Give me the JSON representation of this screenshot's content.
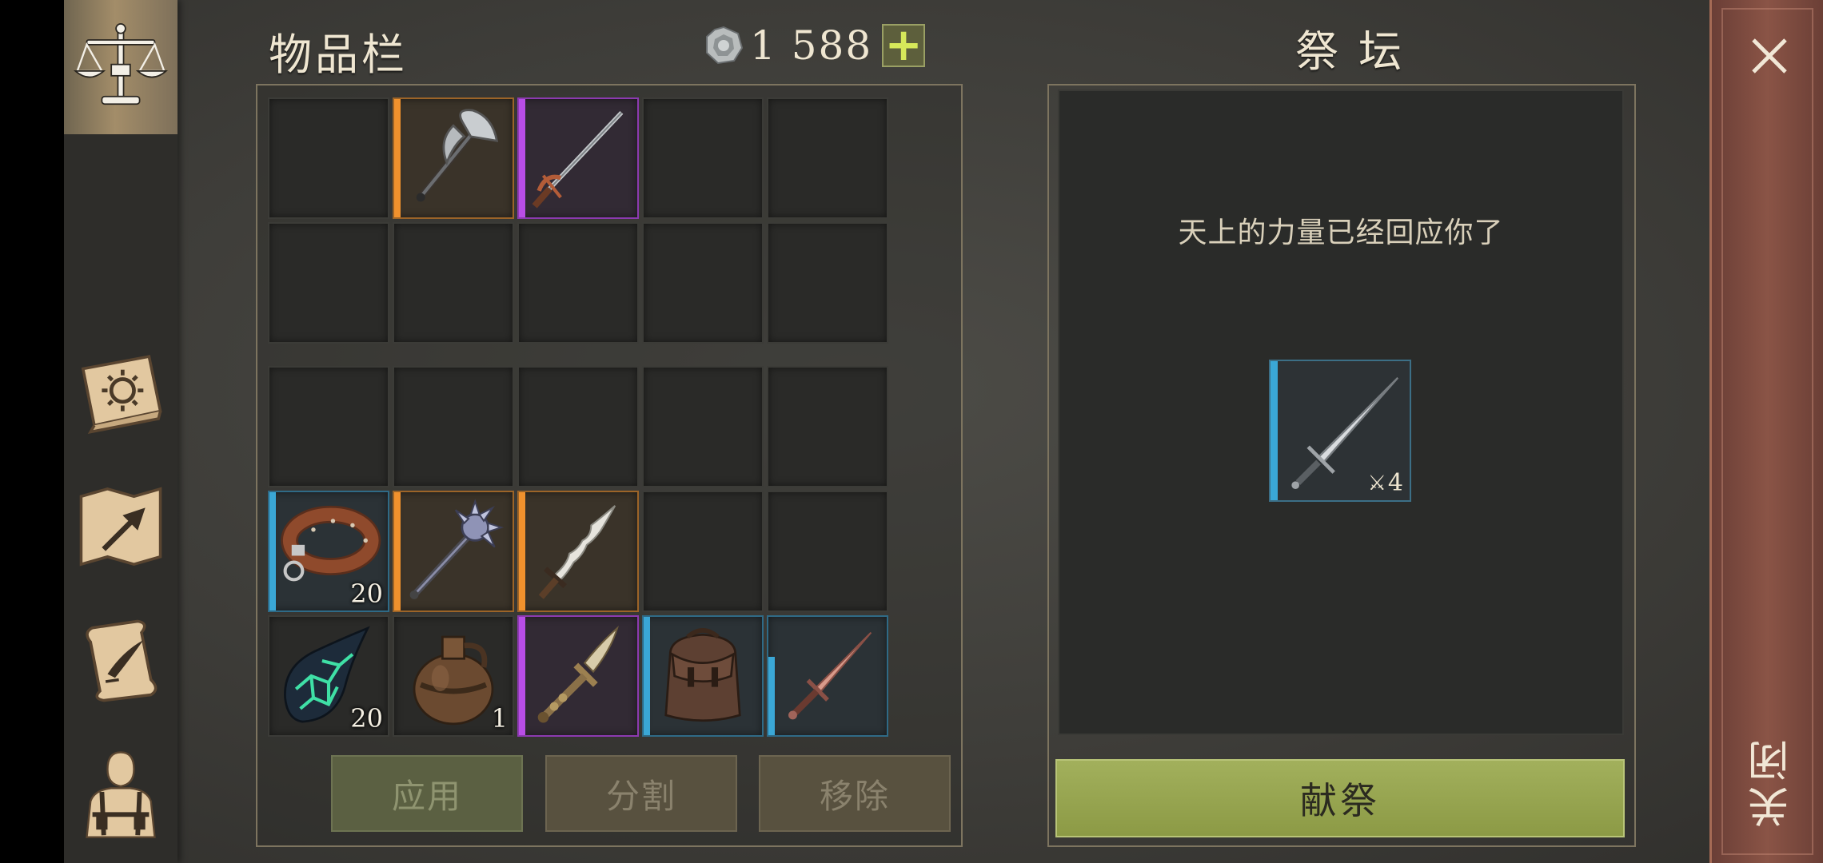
{
  "inventory": {
    "title": "物品栏",
    "currency": "1 588",
    "add_label": "+",
    "equipped_slots": [
      {
        "name": "empty",
        "rarity": "none",
        "icon": ""
      },
      {
        "name": "battle-axe",
        "rarity": "orange",
        "icon": "battle-axe-icon"
      },
      {
        "name": "rapier",
        "rarity": "purple",
        "icon": "rapier-icon"
      },
      {
        "name": "empty",
        "rarity": "none",
        "icon": ""
      },
      {
        "name": "empty",
        "rarity": "none",
        "icon": ""
      },
      {
        "name": "empty",
        "rarity": "none",
        "icon": ""
      },
      {
        "name": "empty",
        "rarity": "none",
        "icon": ""
      },
      {
        "name": "empty",
        "rarity": "none",
        "icon": ""
      },
      {
        "name": "empty",
        "rarity": "none",
        "icon": ""
      },
      {
        "name": "empty",
        "rarity": "none",
        "icon": ""
      }
    ],
    "bag_slots": [
      {
        "rarity": "none",
        "icon": "",
        "count": ""
      },
      {
        "rarity": "none",
        "icon": "",
        "count": ""
      },
      {
        "rarity": "none",
        "icon": "",
        "count": ""
      },
      {
        "rarity": "none",
        "icon": "",
        "count": ""
      },
      {
        "rarity": "none",
        "icon": "",
        "count": ""
      },
      {
        "rarity": "blue",
        "icon": "leather-collar-icon",
        "count": "20"
      },
      {
        "rarity": "orange",
        "icon": "morning-star-mace-icon",
        "count": ""
      },
      {
        "rarity": "orange",
        "icon": "wavy-dagger-icon",
        "count": ""
      },
      {
        "rarity": "none",
        "icon": "",
        "count": ""
      },
      {
        "rarity": "none",
        "icon": "",
        "count": ""
      },
      {
        "rarity": "none",
        "icon": "glowing-green-crystal-icon",
        "count": "20"
      },
      {
        "rarity": "none",
        "icon": "clay-jug-icon",
        "count": "1"
      },
      {
        "rarity": "purple",
        "icon": "spearhead-dagger-icon",
        "count": ""
      },
      {
        "rarity": "blue",
        "icon": "leather-backpack-icon",
        "count": ""
      },
      {
        "rarity": "blue",
        "icon": "copper-sword-icon",
        "count": ""
      }
    ],
    "buttons": {
      "apply": "应用",
      "split": "分割",
      "remove": "移除"
    }
  },
  "altar": {
    "title": "祭 坛",
    "message": "天上的力量已经回应你了",
    "offered_item": {
      "icon": "longsword-icon",
      "rarity": "blue",
      "level": "4"
    },
    "sacrifice_label": "献祭"
  },
  "close": {
    "label": "关闭"
  },
  "sidebar": {
    "items": [
      {
        "icon": "balance-scale-icon",
        "active": true
      },
      {
        "icon": "sun-book-icon",
        "active": false
      },
      {
        "icon": "treasure-map-icon",
        "active": false
      },
      {
        "icon": "quest-scroll-icon",
        "active": false
      },
      {
        "icon": "character-icon",
        "active": false
      }
    ]
  },
  "colors": {
    "rarity_orange": "#f0912d",
    "rarity_purple": "#b84de6",
    "rarity_blue": "#3aa7d6",
    "accent_green": "#8c9a45",
    "close_bar": "#7a4a3e"
  }
}
